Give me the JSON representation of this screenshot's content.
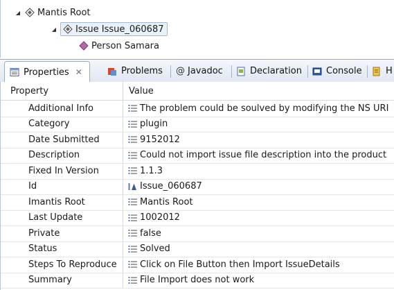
{
  "tree": {
    "root_label": "Mantis Root",
    "issue_label": "Issue Issue_060687",
    "person_label": "Person Samara"
  },
  "tabs": [
    {
      "label": "Properties",
      "icon": "properties-icon",
      "active": true
    },
    {
      "label": "Problems",
      "icon": "problems-icon"
    },
    {
      "label": "Javadoc",
      "icon": "javadoc-at-icon"
    },
    {
      "label": "Declaration",
      "icon": "declaration-icon"
    },
    {
      "label": "Console",
      "icon": "console-icon"
    },
    {
      "label": "H",
      "icon": "history-icon"
    }
  ],
  "table": {
    "header_property": "Property",
    "header_value": "Value",
    "rows": [
      {
        "property": "Additional Info",
        "value": "The problem could be soulved by modifying the NS URI",
        "icon": "text-value-icon"
      },
      {
        "property": "Category",
        "value": "plugin",
        "icon": "text-value-icon"
      },
      {
        "property": "Date Submitted",
        "value": "9152012",
        "icon": "text-value-icon"
      },
      {
        "property": "Description",
        "value": "Could not import issue file description into the product",
        "icon": "text-value-icon"
      },
      {
        "property": "Fixed In Version",
        "value": "1.1.3",
        "icon": "text-value-icon"
      },
      {
        "property": "Id",
        "value": "Issue_060687",
        "icon": "id-value-icon"
      },
      {
        "property": "Imantis Root",
        "value": "Mantis Root",
        "icon": "text-value-icon"
      },
      {
        "property": "Last Update",
        "value": "1002012",
        "icon": "text-value-icon"
      },
      {
        "property": "Private",
        "value": "false",
        "icon": "text-value-icon"
      },
      {
        "property": "Status",
        "value": "Solved",
        "icon": "text-value-icon"
      },
      {
        "property": "Steps To Reproduce",
        "value": "Click on File Button then Import IssueDetails",
        "icon": "text-value-icon"
      },
      {
        "property": "Summary",
        "value": "File Import does not work",
        "icon": "text-value-icon"
      }
    ]
  }
}
